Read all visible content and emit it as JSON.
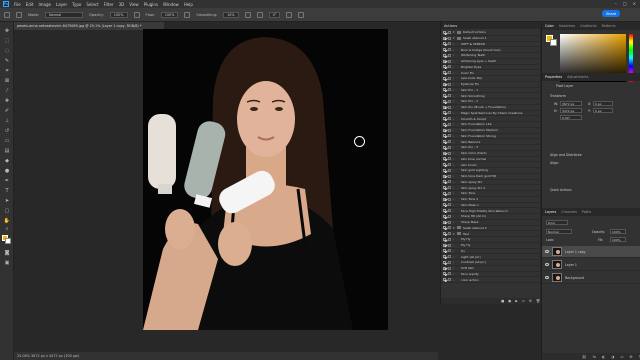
{
  "menu": {
    "logo": "Ps",
    "items": [
      "File",
      "Edit",
      "Image",
      "Layer",
      "Type",
      "Select",
      "Filter",
      "3D",
      "View",
      "Plugins",
      "Window",
      "Help"
    ]
  },
  "options": {
    "mode_label": "Mode:",
    "mode_value": "Normal",
    "opacity_label": "Opacity:",
    "opacity_value": "100%",
    "flow_label": "Flow:",
    "flow_value": "100%",
    "smoothing_label": "Smoothing:",
    "smoothing_value": "10%",
    "angle_value": "0°",
    "share_label": "Share"
  },
  "document": {
    "tab_title": "pexels-anna-nekrashevich-6475069.jpg @ 25.1% (Layer 1 copy, RGB/8) *",
    "status": "25.08%    3672 px x 4472 px (300 ppi)"
  },
  "actions_panel": {
    "title": "Actions",
    "rows": [
      {
        "label": "Default Actions",
        "kind": "set"
      },
      {
        "label": "Saleh Abboud 1",
        "kind": "set"
      },
      {
        "label": "SOFT & SPREAD",
        "kind": "action"
      },
      {
        "label": "Burn & Dodge (brush tool)",
        "kind": "action"
      },
      {
        "label": "Whitening Teeth",
        "kind": "action"
      },
      {
        "label": "whitening eyes + teeth",
        "kind": "action"
      },
      {
        "label": "Brighter Eyes",
        "kind": "action"
      },
      {
        "label": "Color Fix",
        "kind": "action"
      },
      {
        "label": "Lips Color Pop",
        "kind": "action"
      },
      {
        "label": "Eyebrow Fix",
        "kind": "action"
      },
      {
        "label": "Skin Pro - 1",
        "kind": "action"
      },
      {
        "label": "Skin Smoothing",
        "kind": "action"
      },
      {
        "label": "Skin Pro - 2",
        "kind": "action"
      },
      {
        "label": "Skin Pro (Brush + Foundation)",
        "kind": "action"
      },
      {
        "label": "Magic Spot Remover By Chaim Creations",
        "kind": "action"
      },
      {
        "label": "Smooth & Sculpt",
        "kind": "action"
      },
      {
        "label": "Skin Foundation Lite",
        "kind": "action"
      },
      {
        "label": "Skin Foundation Medium",
        "kind": "action"
      },
      {
        "label": "Skin Foundation Strong",
        "kind": "action"
      },
      {
        "label": "Skin Balance",
        "kind": "action"
      },
      {
        "label": "Skin Pro - 3",
        "kind": "action"
      },
      {
        "label": "Skin Color (Dark)",
        "kind": "action"
      },
      {
        "label": "skin tone normal",
        "kind": "action"
      },
      {
        "label": "skin brush",
        "kind": "action"
      },
      {
        "label": "Skin gold Lighting",
        "kind": "action"
      },
      {
        "label": "Skin tone Dark gold HD",
        "kind": "action"
      },
      {
        "label": "Skin spray Pro",
        "kind": "action"
      },
      {
        "label": "Skin spray Pro 2",
        "kind": "action"
      },
      {
        "label": "Skin Tone",
        "kind": "action"
      },
      {
        "label": "Skin Tone 2",
        "kind": "action"
      },
      {
        "label": "Skin Mask 1",
        "kind": "action"
      },
      {
        "label": "Face High Fidelity Skin Retouch",
        "kind": "action"
      },
      {
        "label": "Sharp HD (All In)",
        "kind": "action"
      },
      {
        "label": "Sharp Mask",
        "kind": "action"
      },
      {
        "label": "Saleh Abboud 2",
        "kind": "set"
      },
      {
        "label": "Test",
        "kind": "set"
      },
      {
        "label": "My Hy",
        "kind": "action"
      },
      {
        "label": "My Hy",
        "kind": "action"
      },
      {
        "label": "Hy",
        "kind": "action"
      },
      {
        "label": "Light (all pic)",
        "kind": "action"
      },
      {
        "label": "Contrast (all pic)",
        "kind": "action"
      },
      {
        "label": "Soft Skin",
        "kind": "action"
      },
      {
        "label": "Face Liquify",
        "kind": "action"
      },
      {
        "label": "color action",
        "kind": "action"
      }
    ]
  },
  "color_panel": {
    "tabs": [
      "Color",
      "Swatches",
      "Gradients",
      "Patterns"
    ],
    "fg_color": "#f4b400",
    "bg_color": "#ffffff"
  },
  "properties_panel": {
    "tabs": [
      "Properties",
      "Adjustments"
    ],
    "layer_type": "Pixel Layer",
    "transform_label": "Transform",
    "w_label": "W:",
    "w_value": "3672 px",
    "h_label": "H:",
    "h_value": "3472 px",
    "x_label": "X:",
    "x_value": "0 px",
    "y_label": "Y:",
    "y_value": "0 px",
    "angle_value": "0.00°",
    "align_label": "Align and Distribute",
    "align_sub": "Align:",
    "quick_actions_label": "Quick Actions"
  },
  "layers_panel": {
    "tabs": [
      "Layers",
      "Channels",
      "Paths"
    ],
    "kind_label": "Kind",
    "blend_mode": "Normal",
    "opacity_label": "Opacity:",
    "opacity_value": "100%",
    "lock_label": "Lock:",
    "fill_label": "Fill:",
    "fill_value": "100%",
    "layers": [
      {
        "name": "Layer 1 copy",
        "selected": true
      },
      {
        "name": "Layer 1",
        "selected": false
      },
      {
        "name": "Background",
        "selected": false
      }
    ]
  }
}
